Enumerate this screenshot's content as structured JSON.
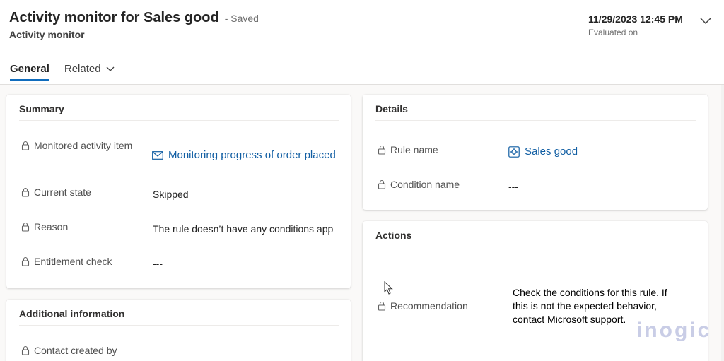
{
  "header": {
    "title": "Activity monitor for Sales good",
    "saved": "- Saved",
    "subtitle": "Activity monitor",
    "evaluated_date": "11/29/2023 12:45 PM",
    "evaluated_label": "Evaluated on"
  },
  "tabs": [
    {
      "label": "General",
      "active": true
    },
    {
      "label": "Related",
      "active": false
    }
  ],
  "summary": {
    "title": "Summary",
    "monitored_label": "Monitored activity item",
    "monitored_value": "Monitoring progress of order placed",
    "state_label": "Current state",
    "state_value": "Skipped",
    "reason_label": "Reason",
    "reason_value": "The rule doesn’t have any conditions app",
    "entitlement_label": "Entitlement check",
    "entitlement_value": "---"
  },
  "details": {
    "title": "Details",
    "rule_label": "Rule name",
    "rule_value": "Sales good",
    "condition_label": "Condition name",
    "condition_value": "---"
  },
  "actions": {
    "title": "Actions",
    "recommendation_label": "Recommendation",
    "recommendation_value": "Check the conditions for this rule. If this is not the expected behavior, contact Microsoft support."
  },
  "additional": {
    "title": "Additional information",
    "contact_label": "Contact created by"
  },
  "watermark": "inogic",
  "colors": {
    "accent": "#0f6cbd",
    "link": "#115ea3",
    "watermark": "#c9cde6"
  },
  "icons": [
    "lock-icon",
    "mail-icon",
    "rule-icon",
    "chevron-down-icon",
    "mouse-cursor-icon"
  ]
}
